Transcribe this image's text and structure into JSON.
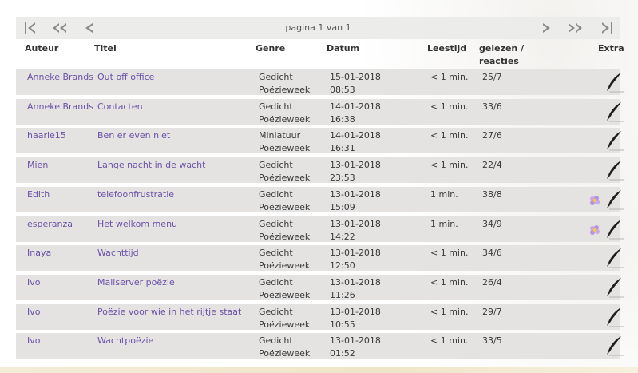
{
  "pager": {
    "label": "pagina 1 van 1",
    "first_icon": "first-page-icon",
    "prev_fast_icon": "rewind-icon",
    "prev_icon": "previous-icon",
    "next_icon": "next-icon",
    "next_fast_icon": "fast-forward-icon",
    "last_icon": "last-page-icon"
  },
  "columns": {
    "author": "Auteur",
    "title": "Titel",
    "genre": "Genre",
    "date": "Datum",
    "read_time": "Leestijd",
    "stats_line1": "gelezen /",
    "stats_line2": "reacties",
    "extra": "Extra"
  },
  "rows": [
    {
      "author": "Anneke Brands",
      "title": "Out off office",
      "genre": "Gedicht",
      "sub": "Poëzieweek",
      "date": "15-01-2018",
      "time": "08:53",
      "read": "< 1 min.",
      "stats": "25/7",
      "flower": false
    },
    {
      "author": "Anneke Brands",
      "title": "Contacten",
      "genre": "Gedicht",
      "sub": "Poëzieweek",
      "date": "14-01-2018",
      "time": "16:38",
      "read": "< 1 min.",
      "stats": "33/6",
      "flower": false
    },
    {
      "author": "haarle15",
      "title": "Ben er even niet",
      "genre": "Miniatuur",
      "sub": "Poëzieweek",
      "date": "14-01-2018",
      "time": "16:31",
      "read": "< 1 min.",
      "stats": "27/6",
      "flower": false
    },
    {
      "author": "Mien",
      "title": "Lange nacht in de wacht",
      "genre": "Gedicht",
      "sub": "Poëzieweek",
      "date": "13-01-2018",
      "time": "23:53",
      "read": "< 1 min.",
      "stats": "22/4",
      "flower": false
    },
    {
      "author": "Edith",
      "title": "telefoonfrustratie",
      "genre": "Gedicht",
      "sub": "Poëzieweek",
      "date": "13-01-2018",
      "time": "15:09",
      "read": "1 min.",
      "stats": "38/8",
      "flower": true
    },
    {
      "author": "esperanza",
      "title": "Het welkom menu",
      "genre": "Gedicht",
      "sub": "Poëzieweek",
      "date": "13-01-2018",
      "time": "14:22",
      "read": "1 min.",
      "stats": "34/9",
      "flower": true
    },
    {
      "author": "Inaya",
      "title": "Wachttijd",
      "genre": "Gedicht",
      "sub": "Poëzieweek",
      "date": "13-01-2018",
      "time": "12:50",
      "read": "< 1 min.",
      "stats": "34/6",
      "flower": false
    },
    {
      "author": "Ivo",
      "title": "Mailserver poëzie",
      "genre": "Gedicht",
      "sub": "Poëzieweek",
      "date": "13-01-2018",
      "time": "11:26",
      "read": "< 1 min.",
      "stats": "26/4",
      "flower": false
    },
    {
      "author": "Ivo",
      "title": "Poëzie voor wie in het rijtje staat",
      "genre": "Gedicht",
      "sub": "Poëzieweek",
      "date": "13-01-2018",
      "time": "10:55",
      "read": "< 1 min.",
      "stats": "29/7",
      "flower": false
    },
    {
      "author": "Ivo",
      "title": "Wachtpoëzie",
      "genre": "Gedicht",
      "sub": "Poëzieweek",
      "date": "13-01-2018",
      "time": "01:52",
      "read": "< 1 min.",
      "stats": "33/5",
      "flower": false
    }
  ],
  "row_icons": {
    "pen": "quill-pen-icon",
    "flower": "flower-icon"
  }
}
